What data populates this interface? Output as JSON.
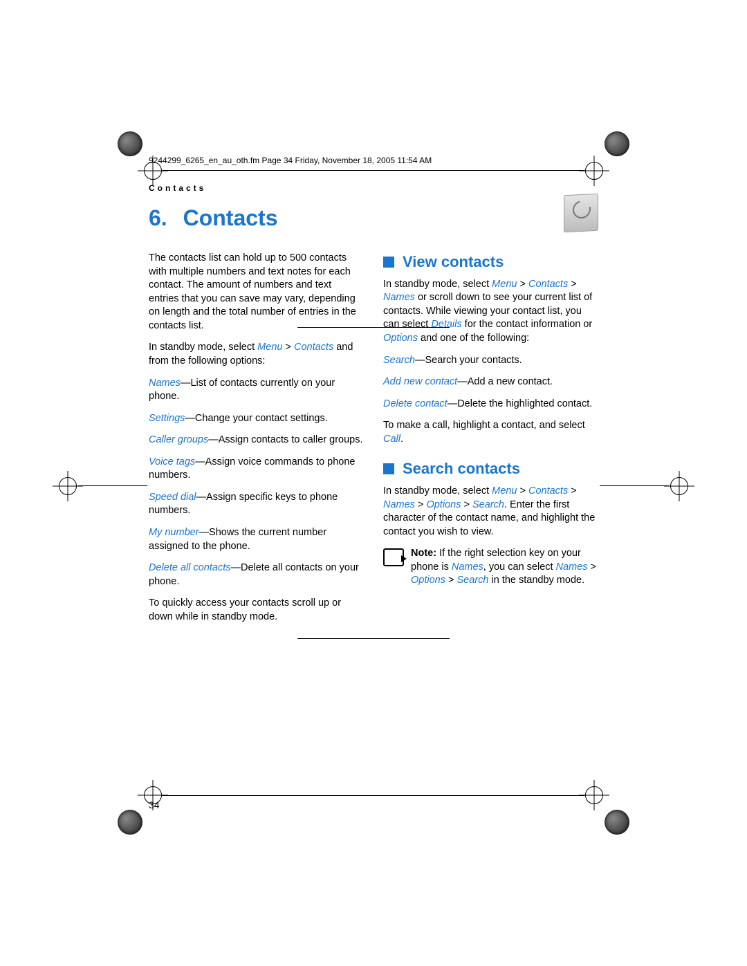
{
  "meta": {
    "header_line": "9244299_6265_en_au_oth.fm  Page 34  Friday, November 18, 2005  11:54 AM",
    "running_head": "Contacts",
    "page_number": "34"
  },
  "chapter": {
    "number": "6.",
    "title": "Contacts"
  },
  "left_column": {
    "intro": "The contacts list can hold up to 500 contacts with multiple numbers and text notes for each contact. The amount of numbers and text entries that you can save may vary, depending on length and the total number of entries in the contacts list.",
    "standby_pre": "In standby mode, select ",
    "standby_m1": "Menu",
    "standby_sep": " > ",
    "standby_m2": "Contacts",
    "standby_post": " and from the following options:",
    "items": [
      {
        "term": "Names",
        "desc": "—List of contacts currently on your phone."
      },
      {
        "term": "Settings",
        "desc": "—Change your contact settings."
      },
      {
        "term": "Caller groups",
        "desc": "—Assign contacts to caller groups."
      },
      {
        "term": "Voice tags",
        "desc": "—Assign voice commands to phone numbers."
      },
      {
        "term": "Speed dial",
        "desc": "—Assign specific keys to phone numbers."
      },
      {
        "term": "My number",
        "desc": "—Shows the current number assigned to the phone."
      },
      {
        "term": "Delete all contacts",
        "desc": "—Delete all contacts on your phone."
      }
    ],
    "outro": "To quickly access your contacts scroll up or down while in standby mode."
  },
  "right_column": {
    "view": {
      "heading": "View contacts",
      "p1_pre": "In standby mode, select ",
      "p1_m1": "Menu",
      "p1_s1": " > ",
      "p1_m2": "Contacts",
      "p1_s2": " > ",
      "p1_m3": "Names",
      "p1_mid": " or scroll down to see your current list of contacts. While viewing your contact list, you can select ",
      "p1_m4": "Details",
      "p1_mid2": " for the contact information or ",
      "p1_m5": "Options",
      "p1_post": " and one of the following:",
      "items": [
        {
          "term": "Search",
          "desc": "—Search your contacts."
        },
        {
          "term": "Add new contact",
          "desc": "—Add a new contact."
        },
        {
          "term": "Delete contact",
          "desc": "—Delete the highlighted contact."
        }
      ],
      "call_pre": "To make a call, highlight a contact, and select ",
      "call_term": "Call",
      "call_post": "."
    },
    "search": {
      "heading": "Search contacts",
      "p_pre": "In standby mode, select ",
      "m1": "Menu",
      "s": " > ",
      "m2": "Contacts",
      "m3": "Names",
      "m4": "Options",
      "m5": "Search",
      "p_post": ". Enter the first character of the contact name, and highlight the contact you wish to view.",
      "note_bold": "Note:",
      "note_pre": " If the right selection key on your phone is ",
      "note_t1": "Names",
      "note_mid": ", you can select ",
      "note_t2": "Names",
      "note_s": " > ",
      "note_t3": "Options",
      "note_t4": "Search",
      "note_post": " in the standby mode."
    }
  }
}
